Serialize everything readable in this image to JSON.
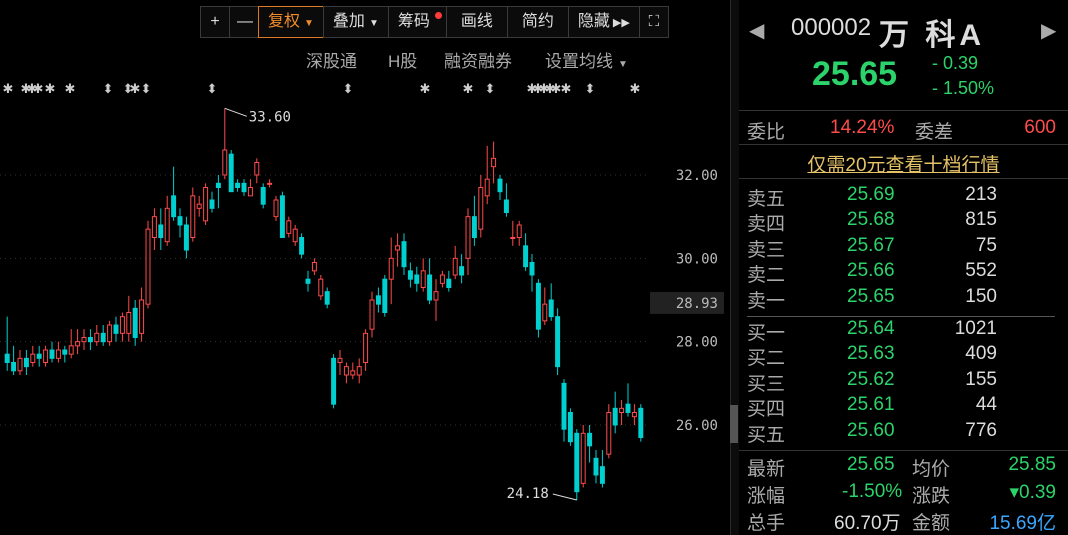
{
  "toolbar": {
    "plus": "+",
    "minus": "—",
    "fuquan": "复权",
    "diejia": "叠加",
    "chouma": "筹码",
    "huaxian": "画线",
    "jianyue": "简约",
    "yincang": "隐藏",
    "fullscreen": "⛶"
  },
  "subtoolbar": {
    "shengutong": "深股通",
    "hgu": "H股",
    "rongzi": "融资融券",
    "junxian": "设置均线"
  },
  "chart_data": {
    "type": "candlestick",
    "y_ticks": [
      "32.00",
      "30.00",
      "28.00",
      "26.00"
    ],
    "ylim": [
      24.18,
      33.6
    ],
    "current_price_label": "28.93",
    "high_label": "33.60",
    "low_label": "24.18",
    "candles": [
      [
        27.7,
        27.5,
        28.6,
        27.3
      ],
      [
        27.5,
        27.3,
        27.9,
        27.2
      ],
      [
        27.3,
        27.6,
        27.8,
        27.2
      ],
      [
        27.6,
        27.4,
        27.8,
        27.2
      ],
      [
        27.5,
        27.7,
        27.9,
        27.4
      ],
      [
        27.7,
        27.6,
        27.9,
        27.4
      ],
      [
        27.5,
        27.8,
        27.9,
        27.4
      ],
      [
        27.8,
        27.6,
        28.0,
        27.5
      ],
      [
        27.6,
        27.8,
        28.0,
        27.5
      ],
      [
        27.8,
        27.7,
        27.9,
        27.5
      ],
      [
        27.7,
        27.9,
        28.3,
        27.6
      ],
      [
        27.9,
        28.0,
        28.3,
        27.7
      ],
      [
        28.0,
        28.1,
        28.3,
        27.8
      ],
      [
        28.1,
        28.0,
        28.3,
        27.8
      ],
      [
        28.0,
        28.2,
        28.4,
        27.9
      ],
      [
        28.2,
        28.0,
        28.4,
        27.9
      ],
      [
        28.0,
        28.4,
        28.5,
        27.9
      ],
      [
        28.4,
        28.2,
        28.6,
        28.0
      ],
      [
        28.2,
        28.6,
        28.7,
        28.0
      ],
      [
        28.2,
        28.7,
        29.1,
        28.0
      ],
      [
        28.8,
        28.1,
        29.0,
        27.9
      ],
      [
        28.2,
        29.0,
        29.3,
        28.0
      ],
      [
        28.9,
        30.7,
        30.9,
        28.8
      ],
      [
        30.5,
        31.0,
        31.2,
        30.2
      ],
      [
        30.8,
        30.5,
        31.2,
        30.2
      ],
      [
        30.4,
        31.2,
        31.5,
        30.3
      ],
      [
        31.5,
        31.0,
        32.2,
        30.9
      ],
      [
        31.0,
        30.8,
        31.2,
        30.5
      ],
      [
        30.8,
        30.2,
        31.0,
        30.0
      ],
      [
        30.5,
        31.5,
        31.7,
        30.4
      ],
      [
        31.2,
        31.3,
        31.5,
        31.0
      ],
      [
        30.9,
        31.7,
        31.8,
        30.8
      ],
      [
        31.4,
        31.2,
        31.6,
        31.1
      ],
      [
        31.8,
        31.7,
        32.0,
        31.2
      ],
      [
        32.0,
        32.6,
        33.6,
        31.9
      ],
      [
        32.5,
        31.6,
        32.6,
        31.6
      ],
      [
        31.8,
        31.7,
        31.9,
        31.6
      ],
      [
        31.8,
        31.6,
        31.9,
        31.5
      ],
      [
        31.5,
        31.7,
        31.9,
        31.5
      ],
      [
        32.0,
        32.3,
        32.4,
        31.8
      ],
      [
        31.7,
        31.3,
        31.8,
        31.2
      ],
      [
        31.8,
        31.8,
        31.9,
        31.7
      ],
      [
        31.0,
        31.4,
        31.5,
        30.9
      ],
      [
        31.5,
        30.5,
        31.6,
        30.5
      ],
      [
        30.6,
        30.9,
        31.0,
        30.5
      ],
      [
        30.4,
        30.7,
        30.8,
        30.3
      ],
      [
        30.5,
        30.1,
        30.6,
        30.0
      ],
      [
        29.5,
        29.4,
        29.7,
        29.2
      ],
      [
        29.7,
        29.9,
        30.0,
        29.6
      ],
      [
        29.1,
        29.5,
        29.6,
        29.0
      ],
      [
        29.2,
        28.9,
        29.3,
        28.8
      ],
      [
        27.6,
        26.5,
        27.7,
        26.4
      ],
      [
        27.5,
        27.6,
        27.8,
        27.2
      ],
      [
        27.2,
        27.4,
        27.5,
        27.0
      ],
      [
        27.2,
        27.3,
        27.5,
        27.1
      ],
      [
        27.2,
        27.4,
        27.6,
        27.0
      ],
      [
        27.5,
        28.2,
        28.3,
        27.3
      ],
      [
        28.3,
        29.0,
        29.2,
        28.1
      ],
      [
        29.1,
        28.9,
        29.3,
        28.7
      ],
      [
        29.5,
        28.7,
        29.6,
        28.6
      ],
      [
        29.5,
        30.0,
        30.5,
        28.9
      ],
      [
        30.2,
        30.3,
        30.6,
        29.8
      ],
      [
        30.4,
        29.8,
        30.6,
        29.6
      ],
      [
        29.7,
        29.5,
        29.9,
        29.3
      ],
      [
        29.6,
        29.4,
        29.8,
        29.2
      ],
      [
        29.3,
        29.7,
        30.0,
        29.2
      ],
      [
        29.6,
        29.0,
        30.0,
        28.9
      ],
      [
        29.0,
        29.2,
        29.5,
        28.5
      ],
      [
        29.4,
        29.6,
        29.7,
        29.3
      ],
      [
        29.5,
        29.3,
        29.7,
        29.2
      ],
      [
        29.6,
        30.0,
        30.3,
        29.5
      ],
      [
        29.8,
        29.6,
        30.1,
        29.4
      ],
      [
        30.0,
        31.0,
        31.2,
        29.6
      ],
      [
        31.0,
        30.5,
        31.5,
        30.3
      ],
      [
        30.7,
        31.7,
        32.0,
        30.5
      ],
      [
        31.5,
        31.9,
        32.7,
        31.3
      ],
      [
        32.2,
        32.4,
        32.8,
        31.8
      ],
      [
        31.9,
        31.6,
        32.0,
        31.4
      ],
      [
        31.4,
        31.1,
        31.8,
        31.0
      ],
      [
        30.5,
        30.5,
        30.9,
        30.3
      ],
      [
        30.5,
        30.8,
        30.9,
        30.3
      ],
      [
        30.3,
        29.8,
        30.6,
        29.7
      ],
      [
        29.9,
        29.6,
        30.1,
        29.2
      ],
      [
        29.4,
        28.3,
        29.5,
        28.1
      ],
      [
        28.5,
        28.9,
        29.3,
        28.4
      ],
      [
        29.0,
        28.6,
        29.4,
        28.5
      ],
      [
        28.6,
        27.4,
        28.8,
        27.2
      ],
      [
        27.0,
        25.9,
        27.1,
        25.6
      ],
      [
        26.3,
        25.6,
        26.4,
        25.5
      ],
      [
        25.8,
        24.4,
        25.9,
        24.2
      ],
      [
        24.6,
        25.8,
        26.0,
        24.5
      ],
      [
        25.8,
        25.5,
        26.0,
        25.1
      ],
      [
        25.2,
        24.8,
        25.4,
        24.6
      ],
      [
        25.0,
        24.6,
        25.4,
        24.5
      ],
      [
        25.3,
        26.3,
        26.5,
        25.2
      ],
      [
        26.4,
        26.0,
        26.8,
        25.8
      ],
      [
        26.3,
        26.4,
        26.6,
        26.0
      ],
      [
        26.5,
        26.3,
        27.0,
        26.2
      ],
      [
        26.2,
        26.3,
        26.5,
        26.0
      ],
      [
        26.4,
        25.7,
        26.5,
        25.6
      ]
    ]
  },
  "quote": {
    "code": "000002",
    "name": "万 科A",
    "last": "25.65",
    "change": "- 0.39",
    "change_pct": "- 1.50%",
    "weibi_label": "委比",
    "weibi": "14.24%",
    "weicha_label": "委差",
    "weicha": "600",
    "promo": "仅需20元查看十档行情",
    "asks": [
      {
        "label": "卖五",
        "price": "25.69",
        "vol": "213"
      },
      {
        "label": "卖四",
        "price": "25.68",
        "vol": "815"
      },
      {
        "label": "卖三",
        "price": "25.67",
        "vol": "75"
      },
      {
        "label": "卖二",
        "price": "25.66",
        "vol": "552"
      },
      {
        "label": "卖一",
        "price": "25.65",
        "vol": "150"
      }
    ],
    "bids": [
      {
        "label": "买一",
        "price": "25.64",
        "vol": "1021"
      },
      {
        "label": "买二",
        "price": "25.63",
        "vol": "409"
      },
      {
        "label": "买三",
        "price": "25.62",
        "vol": "155"
      },
      {
        "label": "买四",
        "price": "25.61",
        "vol": "44"
      },
      {
        "label": "买五",
        "price": "25.60",
        "vol": "776"
      }
    ],
    "stats": {
      "zuixin_label": "最新",
      "zuixin": "25.65",
      "junjia_label": "均价",
      "junjia": "25.85",
      "zhangfu_label": "涨幅",
      "zhangfu": "-1.50%",
      "zhangdie_label": "涨跌",
      "zhangdie": "▾0.39",
      "zongshou_label": "总手",
      "zongshou": "60.70万",
      "jine_label": "金额",
      "jine": "15.69亿"
    }
  },
  "colors": {
    "up": "#ff4b4b",
    "down": "#00d0d0",
    "green": "#2cd36a",
    "red": "#ff4b4b"
  }
}
